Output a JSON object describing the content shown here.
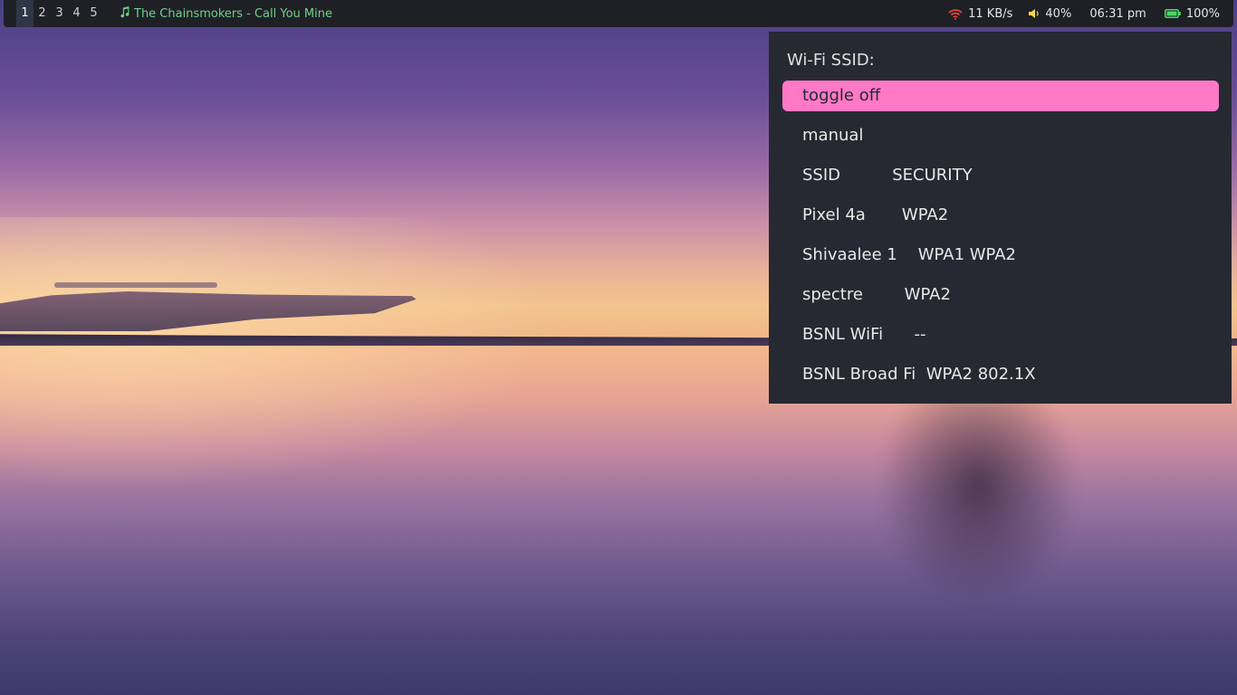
{
  "topbar": {
    "workspaces": [
      "1",
      "2",
      "3",
      "4",
      "5"
    ],
    "active_workspace": "1",
    "media": {
      "icon": "music-note-icon",
      "track": "The Chainsmokers - Call You Mine",
      "color": "#6fd08c"
    },
    "network": {
      "icon": "wifi-icon",
      "speed": "11 KB/s",
      "icon_color": "#e8443a"
    },
    "volume": {
      "icon": "speaker-icon",
      "level": "40%"
    },
    "clock": "06:31 pm",
    "battery": {
      "icon": "battery-icon",
      "level": "100%",
      "color": "#4cd964"
    }
  },
  "wifi_menu": {
    "prompt": "Wi-Fi SSID:",
    "items": [
      "toggle off",
      "manual",
      "SSID          SECURITY",
      "Pixel 4a       WPA2",
      "Shivaalee 1    WPA1 WPA2",
      "spectre        WPA2",
      "BSNL WiFi      --",
      "BSNL Broad Fi  WPA2 802.1X"
    ],
    "selected_index": 0,
    "highlight_color": "#ff79c6"
  }
}
